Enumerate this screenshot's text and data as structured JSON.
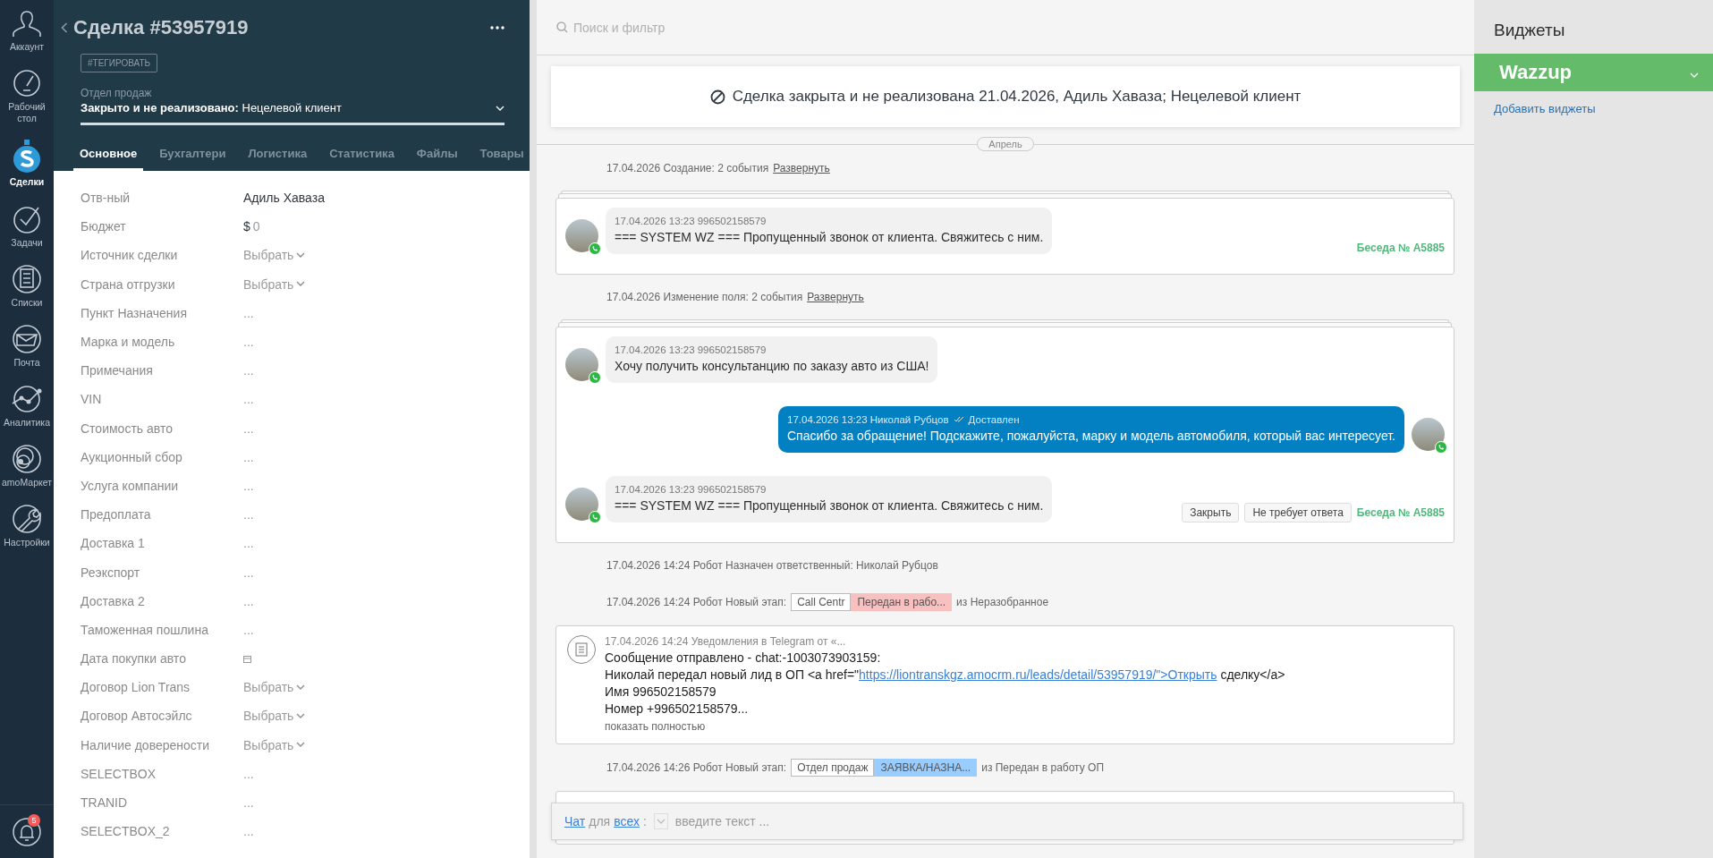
{
  "nav": {
    "items": [
      {
        "label": "Аккаунт",
        "selected": false
      },
      {
        "label": "Рабочий стол",
        "selected": false
      },
      {
        "label": "Сделки",
        "selected": true
      },
      {
        "label": "Задачи",
        "selected": false
      },
      {
        "label": "Списки",
        "selected": false
      },
      {
        "label": "Почта",
        "selected": false
      },
      {
        "label": "Аналитика",
        "selected": false
      },
      {
        "label": "amoМаркет",
        "selected": false
      },
      {
        "label": "Настройки",
        "selected": false
      }
    ],
    "notifications": "5"
  },
  "deal": {
    "title": "Сделка #53957919",
    "tag_button": "#ТЕГИРОВАТЬ",
    "pipeline": "Отдел продаж",
    "status": "**Закрыто и не реализовано:** Нецелевой клиент",
    "tabs": [
      {
        "label": "Основное",
        "selected": true
      },
      {
        "label": "Бухгалтери",
        "selected": false
      },
      {
        "label": "Логистика",
        "selected": false
      },
      {
        "label": "Статистика",
        "selected": false
      },
      {
        "label": "Файлы",
        "selected": false
      },
      {
        "label": "Товары",
        "selected": false
      }
    ],
    "fields": [
      {
        "label": "Отв-ный",
        "kind": "text",
        "value": "Адиль Хаваза"
      },
      {
        "label": "Бюджет",
        "kind": "money",
        "currency": "$",
        "value": "0"
      },
      {
        "label": "Источник сделки",
        "kind": "select",
        "placeholder": "Выбрать"
      },
      {
        "label": "Страна отгрузки",
        "kind": "select",
        "placeholder": "Выбрать"
      },
      {
        "label": "Пункт Назначения",
        "kind": "empty",
        "placeholder": "..."
      },
      {
        "label": "Марка и модель",
        "kind": "empty",
        "placeholder": "..."
      },
      {
        "label": "Примечания",
        "kind": "empty",
        "placeholder": "..."
      },
      {
        "label": "VIN",
        "kind": "empty",
        "placeholder": "..."
      },
      {
        "label": "Стоимость авто",
        "kind": "empty",
        "placeholder": "..."
      },
      {
        "label": "Аукционный сбор",
        "kind": "empty",
        "placeholder": "..."
      },
      {
        "label": "Услуга компании",
        "kind": "empty",
        "placeholder": "..."
      },
      {
        "label": "Предоплата",
        "kind": "empty",
        "placeholder": "..."
      },
      {
        "label": "Доставка 1",
        "kind": "empty",
        "placeholder": "..."
      },
      {
        "label": "Реэкспорт",
        "kind": "empty",
        "placeholder": "..."
      },
      {
        "label": "Доставка 2",
        "kind": "empty",
        "placeholder": "..."
      },
      {
        "label": "Таможенная пошлина",
        "kind": "empty",
        "placeholder": "..."
      },
      {
        "label": "Дата покупки авто",
        "kind": "date"
      },
      {
        "label": "Договор Lion Trans",
        "kind": "select",
        "placeholder": "Выбрать"
      },
      {
        "label": "Договор Автосэйлс",
        "kind": "select",
        "placeholder": "Выбрать"
      },
      {
        "label": "Наличие доверености",
        "kind": "select",
        "placeholder": "Выбрать"
      },
      {
        "label": "SELECTBOX",
        "kind": "empty",
        "placeholder": "..."
      },
      {
        "label": "TRANID",
        "kind": "empty",
        "placeholder": "..."
      },
      {
        "label": "SELECTBOX_2",
        "kind": "empty",
        "placeholder": "..."
      }
    ]
  },
  "feed": {
    "search_placeholder": "Поиск и фильтр",
    "closed_banner": "Сделка закрыта и не реализована 21.04.2026, Адиль Хаваза; Нецелевой клиент",
    "month": "Апрель",
    "events": [
      {
        "kind": "summary",
        "text": "17.04.2026 Создание: 2 события",
        "link": "Развернуть"
      },
      {
        "kind": "chat",
        "messages": [
          {
            "kind": "incoming",
            "meta": "17.04.2026 13:23 996502158579",
            "text": "=== SYSTEM WZ === Пропущенный звонок от клиента. Свяжитесь с ним."
          }
        ],
        "conversation": "Беседа № A5885"
      },
      {
        "kind": "summary",
        "text": "17.04.2026 Изменение поля: 2 события",
        "link": "Развернуть"
      },
      {
        "kind": "chat",
        "messages": [
          {
            "kind": "incoming",
            "meta": "17.04.2026 13:23 996502158579",
            "text": "Хочу получить консультанцию по заказу авто из США!"
          },
          {
            "kind": "outgoing",
            "meta": "17.04.2026 13:23 Николай Рубцов",
            "status": "Доставлен",
            "text": "Спасибо за обращение! Подскажите, пожалуйста, марку и модель автомобиля, который вас интересует."
          },
          {
            "kind": "incoming",
            "meta": "17.04.2026 13:23 996502158579",
            "text": "=== SYSTEM WZ === Пропущенный звонок от клиента. Свяжитесь с ним."
          }
        ],
        "actions": [
          "Закрыть",
          "Не требует ответа"
        ],
        "conversation": "Беседа № A5885"
      },
      {
        "kind": "system",
        "text": "17.04.2026 14:24 Робот Назначен ответственный: Николай Рубцов"
      },
      {
        "kind": "stage",
        "prefix": "17.04.2026 14:24 Робот Новый этап:",
        "pipeline": "Call Centr",
        "stage": "Передан в рабо...",
        "color": "#f9c0c0",
        "suffix": "из Неразобранное"
      },
      {
        "kind": "note",
        "meta": "17.04.2026 14:24 Уведомления в Telegram от «...",
        "lines": [
          [
            {
              "kind": "text",
              "text": "Сообщение отправлено - chat:-1003073903159:"
            }
          ],
          [
            {
              "kind": "text",
              "text": "Николай передал новый лид в ОП <a href=\""
            },
            {
              "kind": "link",
              "text": "https://liontranskgz.amocrm.ru/leads/detail/53957919/\">Открыть"
            },
            {
              "kind": "text",
              "text": " сделку</a>"
            }
          ],
          [
            {
              "kind": "text",
              "text": "Имя 996502158579"
            }
          ],
          [
            {
              "kind": "text",
              "text": "Номер +996502158579..."
            }
          ]
        ],
        "more": "показать полностью"
      },
      {
        "kind": "stage",
        "prefix": "17.04.2026 14:26 Робот Новый этап:",
        "pipeline": "Отдел продаж",
        "stage": "ЗАЯВКА/НАЗНА...",
        "color": "#99ccff",
        "suffix": "из Передан в работу ОП"
      },
      {
        "kind": "stub"
      }
    ],
    "chat_input": {
      "chat_link": "Чат",
      "for": "для",
      "audience_link": "всех",
      "separator": ":",
      "placeholder": "введите текст ..."
    }
  },
  "widgets": {
    "title": "Виджеты",
    "items": [
      {
        "name": "Wazzup"
      }
    ],
    "add_link": "Добавить виджеты"
  }
}
